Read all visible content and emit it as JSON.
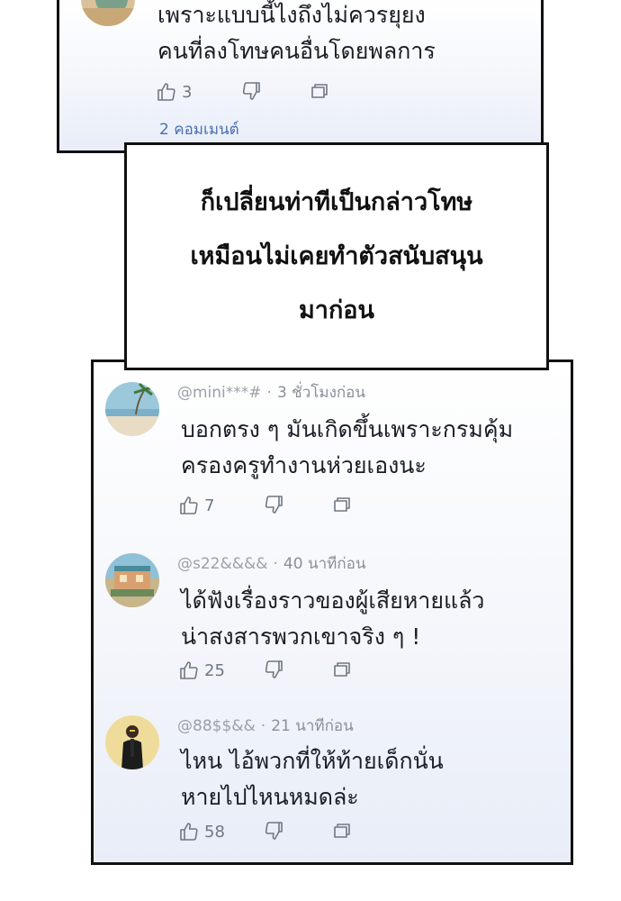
{
  "top_comment": {
    "lines": [
      "เพราะแบบนี้ไงถึงไม่ควรยุยง",
      "คนที่ลงโทษคนอื่นโดยพลการ"
    ],
    "likes": "3",
    "replies_link": "2 คอมเมนต์"
  },
  "caption": {
    "lines": [
      "ก็เปลี่ยนท่าทีเป็นกล่าวโทษ",
      "เหมือนไม่เคยทำตัวสนับสนุน",
      "มาก่อน"
    ]
  },
  "comments": [
    {
      "user": "@mini***#",
      "time": "3 ชั่วโมงก่อน",
      "lines": [
        "บอกตรง ๆ มันเกิดขึ้นเพราะกรมคุ้ม",
        "ครองครูทำงานห่วยเองนะ"
      ],
      "likes": "7"
    },
    {
      "user": "@s22&&&&",
      "time": "40 นาทีก่อน",
      "lines": [
        "ได้ฟังเรื่องราวของผู้เสียหายแล้ว",
        "น่าสงสารพวกเขาจริง ๆ !"
      ],
      "likes": "25"
    },
    {
      "user": "@88$$&&",
      "time": "21 นาทีก่อน",
      "lines": [
        "ไหน ไอ้พวกที่ให้ท้ายเด็กนั่น",
        "หายไปไหนหมดล่ะ"
      ],
      "likes": "58"
    }
  ],
  "icons": {
    "like": "thumbs-up-icon",
    "dislike": "thumbs-down-icon",
    "reply": "reply-icon"
  },
  "colors": {
    "username": "#9aa0aa",
    "link": "#4a6fb0",
    "text": "#1b1e26"
  }
}
